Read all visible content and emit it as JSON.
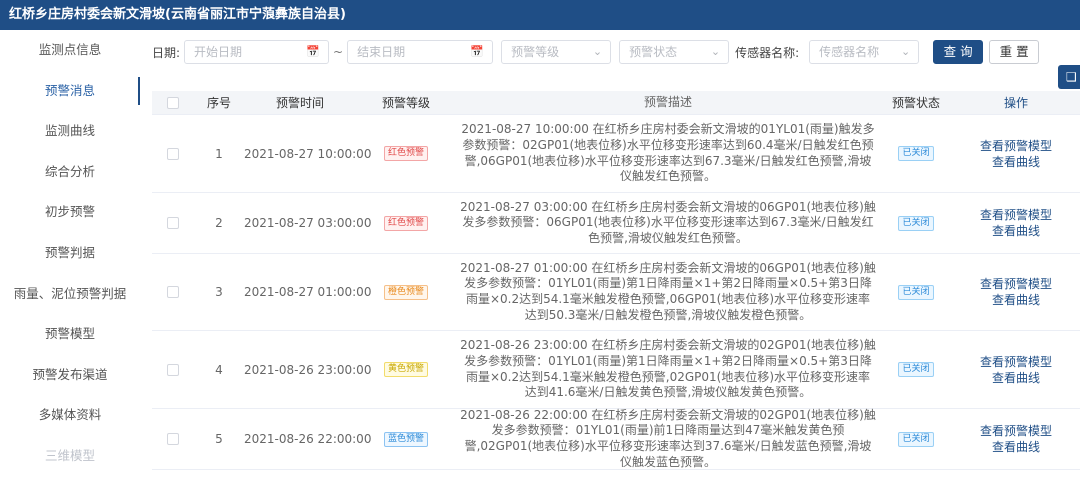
{
  "header": {
    "title": "红桥乡庄房村委会新文滑坡(云南省丽江市宁蒗彝族自治县)"
  },
  "sidebar": {
    "items": [
      {
        "label": "监测点信息"
      },
      {
        "label": "预警消息"
      },
      {
        "label": "监测曲线"
      },
      {
        "label": "综合分析"
      },
      {
        "label": "初步预警"
      },
      {
        "label": "预警判据"
      },
      {
        "label": "雨量、泥位预警判据"
      },
      {
        "label": "预警模型"
      },
      {
        "label": "预警发布渠道"
      },
      {
        "label": "多媒体资料"
      },
      {
        "label": "三维模型"
      }
    ]
  },
  "filters": {
    "date_label": "日期:",
    "start_placeholder": "开始日期",
    "separator": "~",
    "end_placeholder": "结束日期",
    "level_placeholder": "预警等级",
    "status_placeholder": "预警状态",
    "sensor_label": "传感器名称:",
    "sensor_placeholder": "传感器名称",
    "search_label": "查 询",
    "reset_label": "重 置"
  },
  "table": {
    "headers": {
      "no": "序号",
      "time": "预警时间",
      "level": "预警等级",
      "desc": "预警描述",
      "status": "预警状态",
      "ops": "操作"
    },
    "rows": [
      {
        "no": "1",
        "time": "2021-08-27 10:00:00",
        "level": "红色预警",
        "desc": "2021-08-27 10:00:00 在红桥乡庄房村委会新文滑坡的01YL01(雨量)触发多参数预警：02GP01(地表位移)水平位移变形速率达到60.4毫米/日触发红色预警,06GP01(地表位移)水平位移变形速率达到67.3毫米/日触发红色预警,滑坡仪触发红色预警。",
        "status": "已关闭",
        "op1": "查看预警模型",
        "op2": "查看曲线"
      },
      {
        "no": "2",
        "time": "2021-08-27 03:00:00",
        "level": "红色预警",
        "desc": "2021-08-27 03:00:00 在红桥乡庄房村委会新文滑坡的06GP01(地表位移)触发多参数预警：06GP01(地表位移)水平位移变形速率达到67.3毫米/日触发红色预警,滑坡仪触发红色预警。",
        "status": "已关闭",
        "op1": "查看预警模型",
        "op2": "查看曲线"
      },
      {
        "no": "3",
        "time": "2021-08-27 01:00:00",
        "level": "橙色预警",
        "desc": "2021-08-27 01:00:00 在红桥乡庄房村委会新文滑坡的06GP01(地表位移)触发多参数预警：01YL01(雨量)第1日降雨量×1+第2日降雨量×0.5+第3日降雨量×0.2达到54.1毫米触发橙色预警,06GP01(地表位移)水平位移变形速率达到50.3毫米/日触发橙色预警,滑坡仪触发橙色预警。",
        "status": "已关闭",
        "op1": "查看预警模型",
        "op2": "查看曲线"
      },
      {
        "no": "4",
        "time": "2021-08-26 23:00:00",
        "level": "黄色预警",
        "desc": "2021-08-26 23:00:00 在红桥乡庄房村委会新文滑坡的02GP01(地表位移)触发多参数预警：01YL01(雨量)第1日降雨量×1+第2日降雨量×0.5+第3日降雨量×0.2达到54.1毫米触发橙色预警,02GP01(地表位移)水平位移变形速率达到41.6毫米/日触发黄色预警,滑坡仪触发黄色预警。",
        "status": "已关闭",
        "op1": "查看预警模型",
        "op2": "查看曲线"
      },
      {
        "no": "5",
        "time": "2021-08-26 22:00:00",
        "level": "蓝色预警",
        "desc": "2021-08-26 22:00:00 在红桥乡庄房村委会新文滑坡的02GP01(地表位移)触发多参数预警：01YL01(雨量)前1日降雨量达到47毫米触发黄色预警,02GP01(地表位移)水平位移变形速率达到37.6毫米/日触发蓝色预警,滑坡仪触发蓝色预警。",
        "status": "已关闭",
        "op1": "查看预警模型",
        "op2": "查看曲线"
      }
    ]
  },
  "colors": {
    "header_bg": "#1f4e86",
    "link": "#1f4e86",
    "red": "#e04848",
    "orange": "#e8891c",
    "yellow": "#c8a800",
    "blue": "#2b8ad8"
  }
}
